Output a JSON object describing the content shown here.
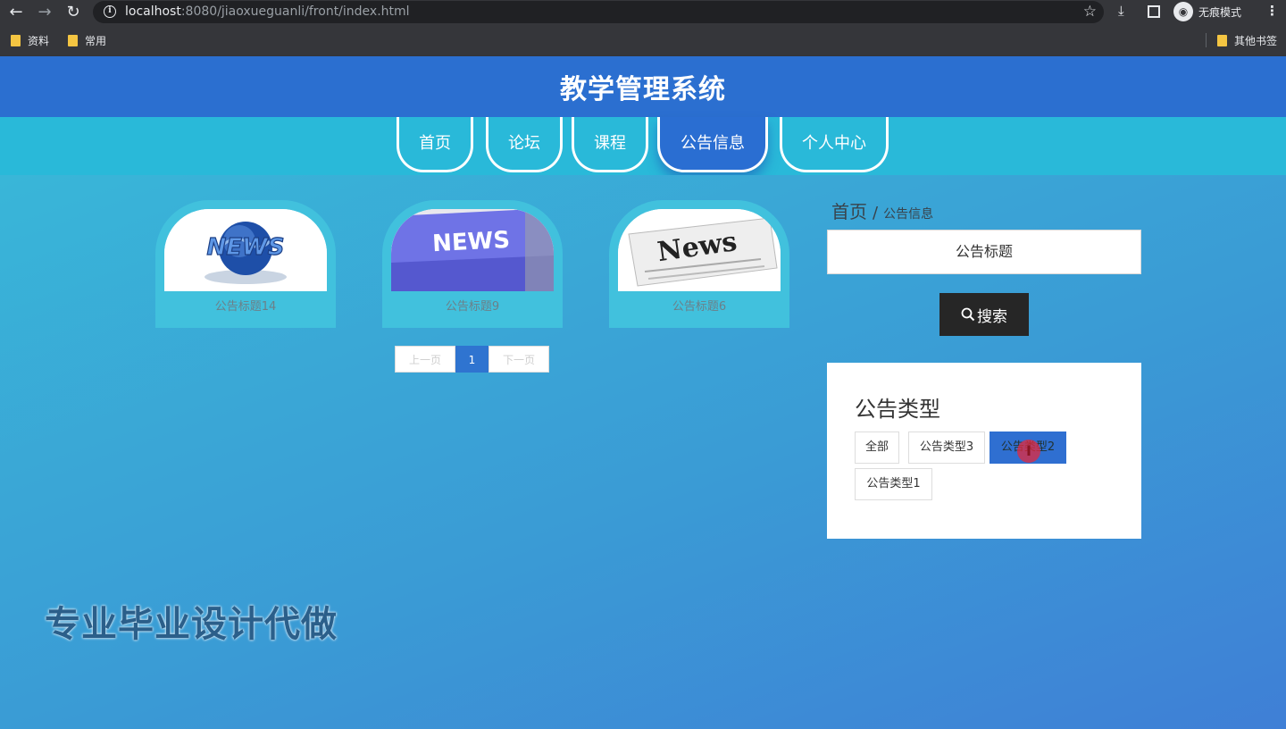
{
  "browser": {
    "back_icon": "←",
    "forward_icon": "→",
    "reload_icon": "↻",
    "url_host": "localhost",
    "url_rest": ":8080/jiaoxueguanli/front/index.html",
    "incognito_label": "无痕模式",
    "bookmarks": [
      "资料",
      "常用"
    ],
    "other_bookmarks": "其他书签"
  },
  "site": {
    "title": "教学管理系统"
  },
  "nav": {
    "items": [
      {
        "label": "首页"
      },
      {
        "label": "论坛"
      },
      {
        "label": "课程"
      },
      {
        "label": "公告信息"
      },
      {
        "label": "个人中心"
      }
    ],
    "active": "公告信息"
  },
  "notices": [
    {
      "title": "公告标题14",
      "image": "globe-news-image"
    },
    {
      "title": "公告标题9",
      "image": "news-keyboard-key-image"
    },
    {
      "title": "公告标题6",
      "image": "newspaper-image"
    }
  ],
  "pagination": {
    "prev": "上一页",
    "current": "1",
    "next": "下一页"
  },
  "sidebar": {
    "breadcrumb": {
      "home": "首页",
      "separator": "/",
      "current": "公告信息"
    },
    "search_placeholder": "公告标题",
    "search_button": "搜索",
    "type_panel_title": "公告类型",
    "types": [
      {
        "label": "全部",
        "active": false
      },
      {
        "label": "公告类型3",
        "active": false
      },
      {
        "label": "公告类型2",
        "active": true
      },
      {
        "label": "公告类型1",
        "active": false
      }
    ]
  },
  "watermark": "专业毕业设计代做",
  "colors": {
    "header": "#2b6fd0",
    "nav_strip": "#29b9d9",
    "active_nav": "#2a6ed2",
    "search_button": "#262626",
    "active_tag": "#2f6fd1"
  }
}
